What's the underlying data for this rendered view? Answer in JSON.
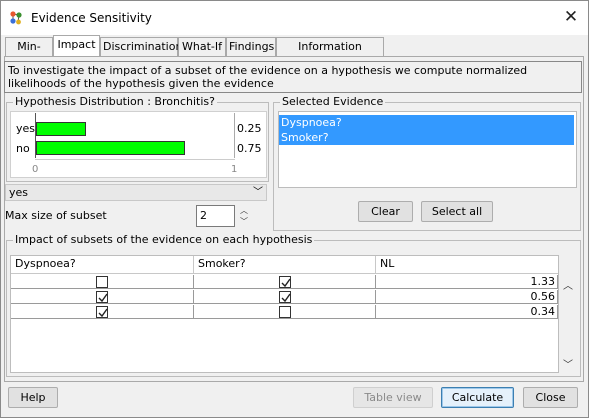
{
  "window": {
    "title": "Evidence Sensitivity",
    "close_glyph": "✕"
  },
  "tabs": [
    {
      "label": "Min-Max",
      "active": false
    },
    {
      "label": "Impact",
      "active": true
    },
    {
      "label": "Discrimination",
      "active": false
    },
    {
      "label": "What-If",
      "active": false
    },
    {
      "label": "Findings",
      "active": false
    },
    {
      "label": "Information Variables",
      "active": false
    }
  ],
  "description": "To investigate the impact of a subset of the evidence on a hypothesis we compute normalized likelihoods of the hypothesis given the evidence",
  "hypothesis": {
    "group_title": "Hypothesis Distribution : Bronchitis?",
    "bar_color": "#00ff00",
    "states": [
      {
        "label": "yes",
        "value": 0.25,
        "value_text": "0.25"
      },
      {
        "label": "no",
        "value": 0.75,
        "value_text": "0.75"
      }
    ],
    "axis_min": "0",
    "axis_max": "1",
    "selected_state": "yes",
    "max_subset_label": "Max size of subset",
    "max_subset_value": "2"
  },
  "evidence": {
    "group_title": "Selected Evidence",
    "items": [
      "Dyspnoea?",
      "Smoker?"
    ],
    "clear_label": "Clear",
    "select_all_label": "Select all"
  },
  "impact": {
    "group_title": "Impact of subsets of the evidence on each hypothesis",
    "columns": [
      "Dyspnoea?",
      "Smoker?",
      "NL"
    ],
    "rows": [
      {
        "dyspnoea": false,
        "smoker": true,
        "nl": "1.33"
      },
      {
        "dyspnoea": true,
        "smoker": true,
        "nl": "0.56"
      },
      {
        "dyspnoea": true,
        "smoker": false,
        "nl": "0.34"
      }
    ]
  },
  "buttons": {
    "help": "Help",
    "table_view": "Table view",
    "calculate": "Calculate",
    "close": "Close"
  }
}
